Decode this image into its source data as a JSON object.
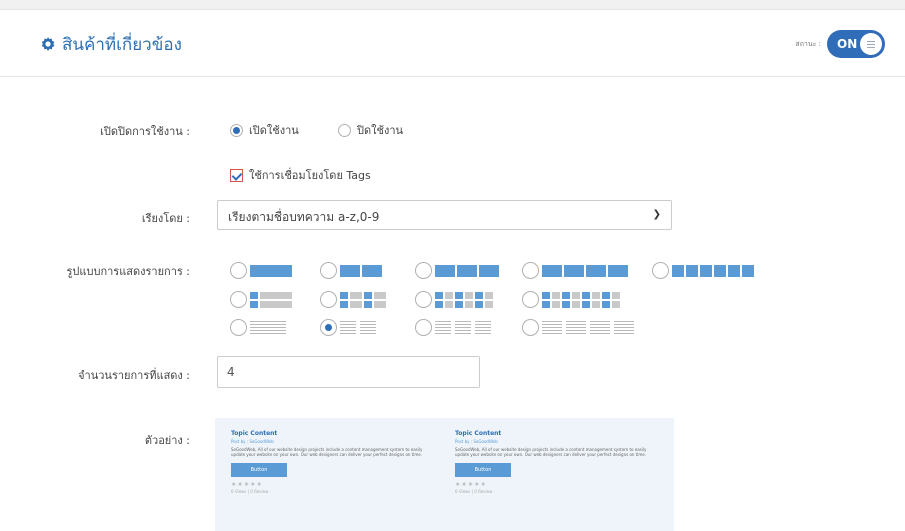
{
  "header": {
    "title": "สินค้าที่เกี่ยวข้อง",
    "status_label": "สถานะ :",
    "toggle_label": "ON"
  },
  "enable": {
    "label": "เปิดปิดการใช้งาน :",
    "options": [
      "เปิดใช้งาน",
      "ปิดใช้งาน"
    ],
    "selected": "เปิดใช้งาน"
  },
  "tags": {
    "label": "ใช้การเชื่อมโยงโดย Tags",
    "checked": true
  },
  "sort": {
    "label": "เรียงโดย :",
    "value": "เรียงตามชื่อบทความ a-z,0-9"
  },
  "layout": {
    "label": "รูปแบบการแสดงรายการ :",
    "selected_option": "list-2-columns"
  },
  "count": {
    "label": "จำนวนรายการที่แสดง :",
    "value": "4"
  },
  "preview": {
    "label": "ตัวอย่าง :",
    "cards": [
      {
        "title": "Topic Content",
        "subtitle": "Post by : SoGoodWeb",
        "description": "SoGoodWeb, All of our website design projects include a content management system to easily update your website on your own. Our web designers can deliver your perfect designs on time.",
        "button": "Button",
        "stars": "★★★★★",
        "meta": "0 Views | 0 Review"
      },
      {
        "title": "Topic Content",
        "subtitle": "Post by : SoGoodWeb",
        "description": "SoGoodWeb, All of our website design projects include a content management system to easily update your website on your own. Our web designers can deliver your perfect designs on time.",
        "button": "Button",
        "stars": "★★★★★",
        "meta": "0 Views | 0 Review"
      }
    ]
  },
  "colors": {
    "accent": "#2f6db8",
    "tile": "#5b9bd5"
  }
}
